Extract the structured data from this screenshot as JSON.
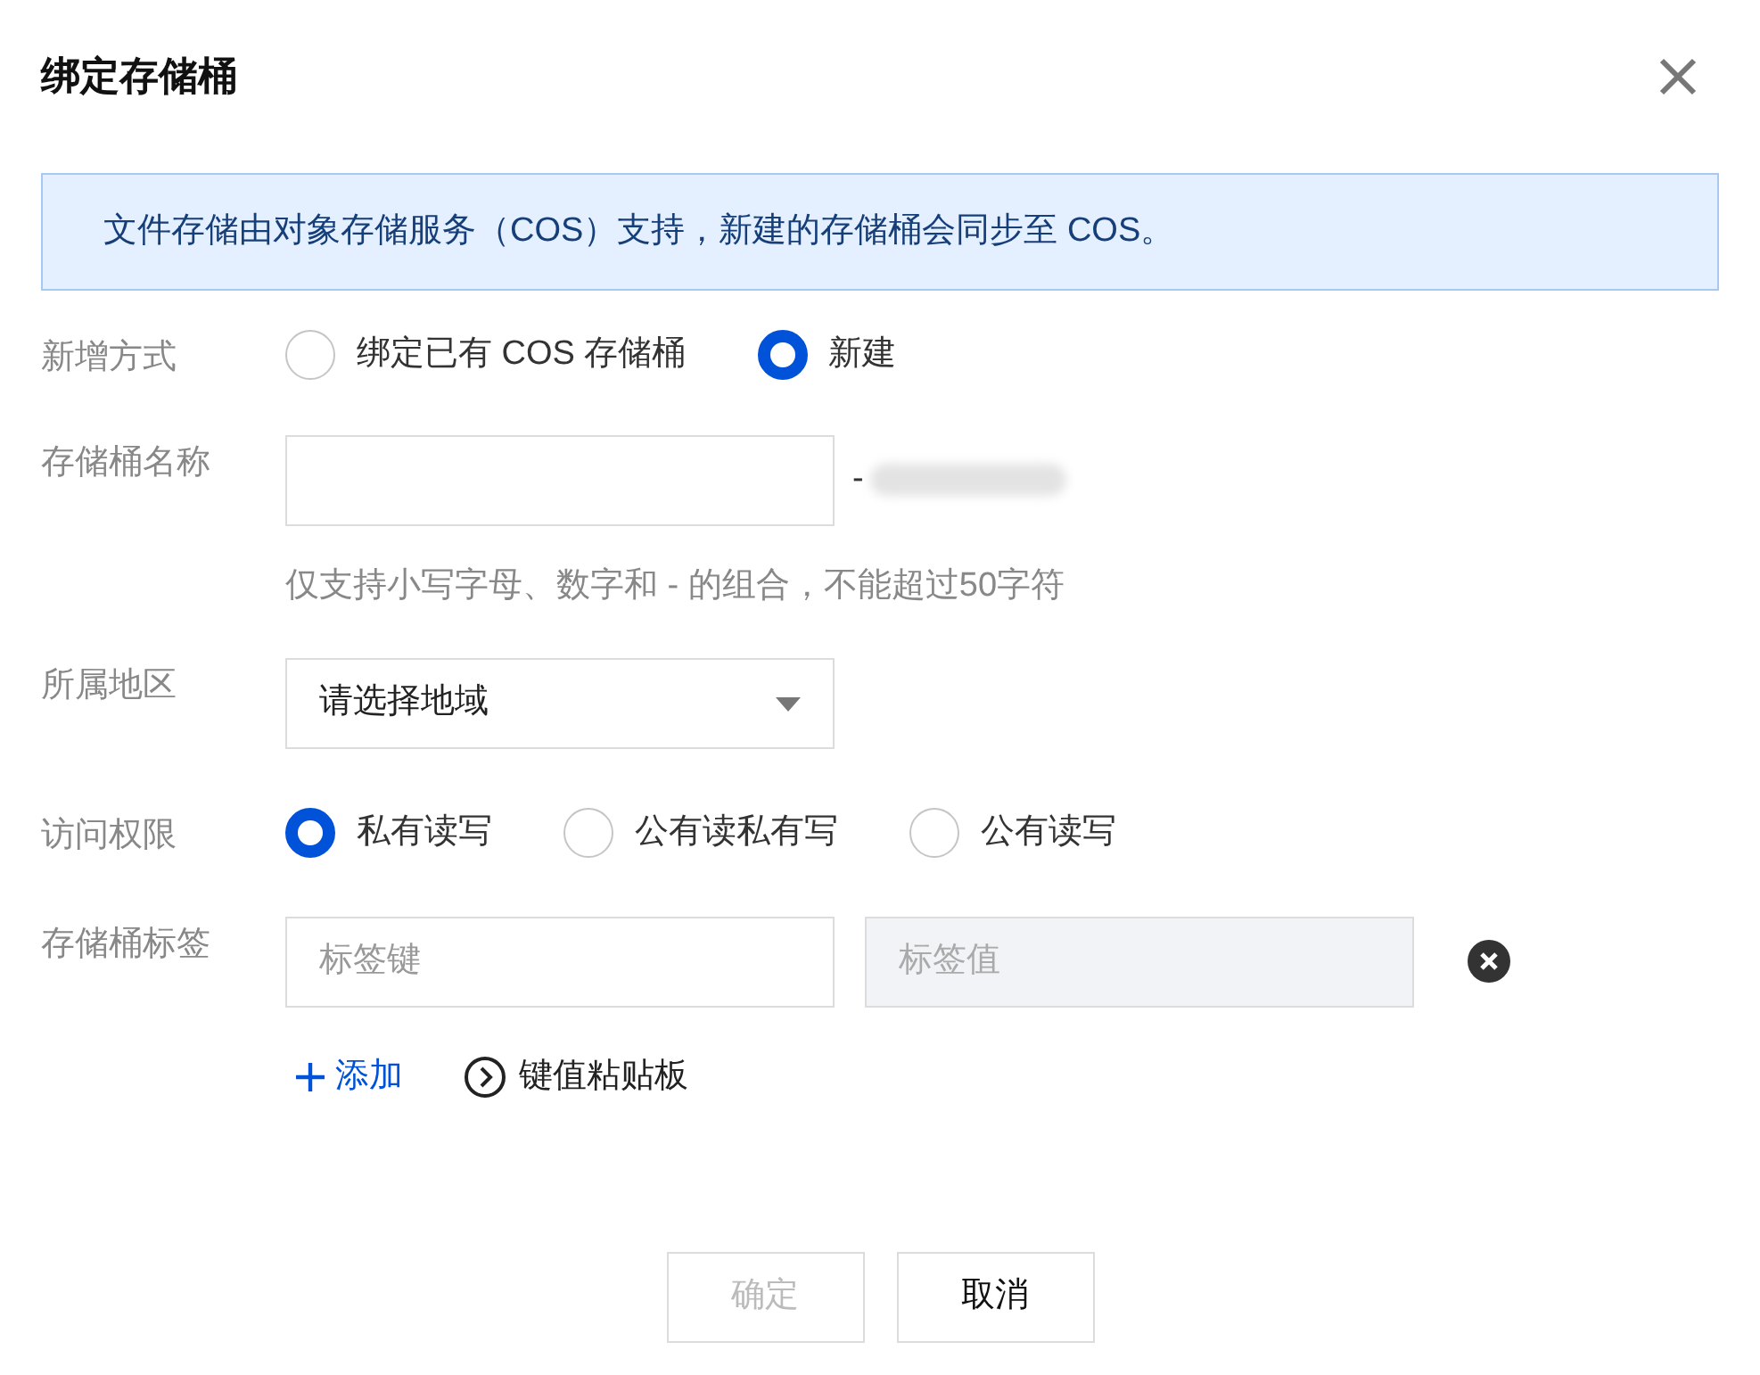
{
  "dialog": {
    "title": "绑定存储桶"
  },
  "notice": "文件存储由对象存储服务（COS）支持，新建的存储桶会同步至 COS。",
  "add_method": {
    "label": "新增方式",
    "options": [
      {
        "label": "绑定已有 COS 存储桶",
        "selected": false
      },
      {
        "label": "新建",
        "selected": true
      }
    ]
  },
  "bucket_name": {
    "label": "存储桶名称",
    "separator": "-",
    "hint": "仅支持小写字母、数字和 - 的组合，不能超过50字符"
  },
  "region": {
    "label": "所属地区",
    "placeholder": "请选择地域"
  },
  "access": {
    "label": "访问权限",
    "options": [
      {
        "label": "私有读写",
        "selected": true
      },
      {
        "label": "公有读私有写",
        "selected": false
      },
      {
        "label": "公有读写",
        "selected": false
      }
    ]
  },
  "tags": {
    "label": "存储桶标签",
    "key_placeholder": "标签键",
    "value_placeholder": "标签值",
    "value_disabled": true,
    "add": "添加",
    "paste": "键值粘贴板"
  },
  "buttons": [
    {
      "label": "确定",
      "disabled": true
    },
    {
      "label": "取消",
      "disabled": false
    }
  ]
}
